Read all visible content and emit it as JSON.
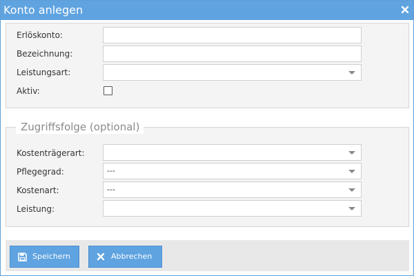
{
  "dialog": {
    "title": "Konto anlegen",
    "close_icon": "close-icon"
  },
  "form": {
    "erloeskonto_label": "Erlöskonto:",
    "erloeskonto_value": "",
    "bezeichnung_label": "Bezeichnung:",
    "bezeichnung_value": "",
    "leistungsart_label": "Leistungsart:",
    "leistungsart_value": "",
    "aktiv_label": "Aktiv:",
    "aktiv_checked": false
  },
  "zugriffsfolge": {
    "legend": "Zugriffsfolge (optional)",
    "kostentraegerart_label": "Kostenträgerart:",
    "kostentraegerart_value": "",
    "pflegegrad_label": "Pflegegrad:",
    "pflegegrad_value": "---",
    "kostenart_label": "Kostenart:",
    "kostenart_value": "---",
    "leistung_label": "Leistung:",
    "leistung_value": ""
  },
  "footer": {
    "save_label": "Speichern",
    "save_icon": "save-icon",
    "cancel_label": "Abbrechen",
    "cancel_icon": "close-icon"
  },
  "colors": {
    "accent": "#5fa3e0",
    "panel_bg": "#f4f4f4",
    "border": "#d6d6d6"
  }
}
